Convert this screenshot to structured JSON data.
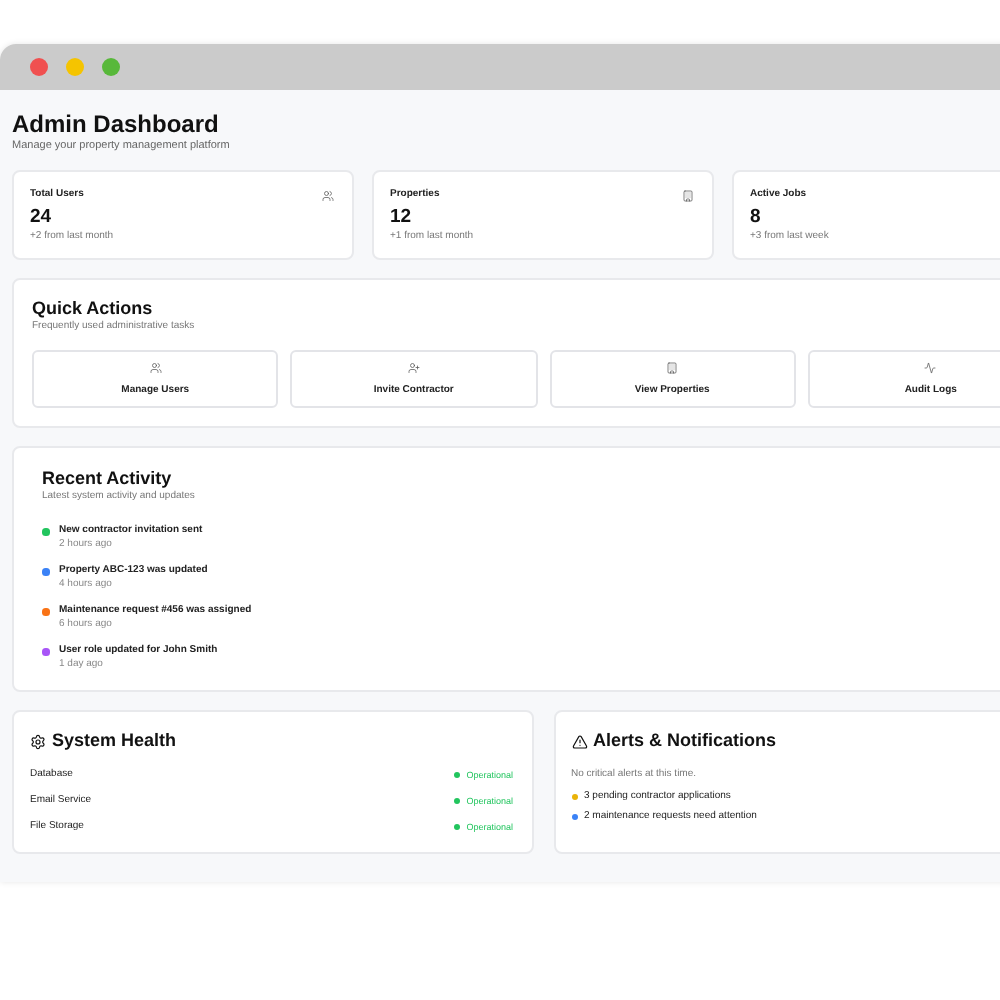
{
  "header": {
    "title": "Admin Dashboard",
    "subtitle": "Manage your property management platform"
  },
  "stats": [
    {
      "label": "Total Users",
      "value": "24",
      "change": "+2 from last month"
    },
    {
      "label": "Properties",
      "value": "12",
      "change": "+1 from last month"
    },
    {
      "label": "Active Jobs",
      "value": "8",
      "change": "+3 from last week"
    }
  ],
  "quick_actions": {
    "title": "Quick Actions",
    "subtitle": "Frequently used administrative tasks",
    "buttons": [
      {
        "label": "Manage Users"
      },
      {
        "label": "Invite Contractor"
      },
      {
        "label": "View Properties"
      },
      {
        "label": "Audit Logs"
      }
    ]
  },
  "recent_activity": {
    "title": "Recent Activity",
    "subtitle": "Latest system activity and updates",
    "items": [
      {
        "text": "New contractor invitation sent",
        "time": "2 hours ago",
        "color": "#22c55e"
      },
      {
        "text": "Property ABC-123 was updated",
        "time": "4 hours ago",
        "color": "#3b82f6"
      },
      {
        "text": "Maintenance request #456 was assigned",
        "time": "6 hours ago",
        "color": "#f97316"
      },
      {
        "text": "User role updated for John Smith",
        "time": "1 day ago",
        "color": "#a855f7"
      }
    ]
  },
  "system_health": {
    "title": "System Health",
    "services": [
      {
        "name": "Database",
        "status": "Operational",
        "color": "#22c55e"
      },
      {
        "name": "Email Service",
        "status": "Operational",
        "color": "#22c55e"
      },
      {
        "name": "File Storage",
        "status": "Operational",
        "color": "#22c55e"
      }
    ]
  },
  "alerts": {
    "title": "Alerts & Notifications",
    "message": "No critical alerts at this time.",
    "items": [
      {
        "text": "3 pending contractor applications",
        "color": "#eab308"
      },
      {
        "text": "2 maintenance requests need attention",
        "color": "#3b82f6"
      }
    ]
  }
}
